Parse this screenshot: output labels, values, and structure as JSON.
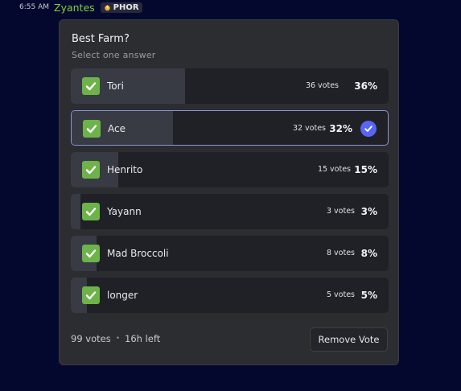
{
  "message": {
    "timestamp": "6:55 AM",
    "username": "Zyantes",
    "tag": {
      "icon": "fire-badge-icon",
      "text": "PHOR"
    }
  },
  "poll": {
    "question": "Best Farm?",
    "subtitle": "Select one answer",
    "answers": [
      {
        "label": "Tori",
        "votes": "36 votes",
        "percent": "36%",
        "fraction": 0.36,
        "selected": false
      },
      {
        "label": "Ace",
        "votes": "32 votes",
        "percent": "32%",
        "fraction": 0.32,
        "selected": true
      },
      {
        "label": "Henrito",
        "votes": "15 votes",
        "percent": "15%",
        "fraction": 0.15,
        "selected": false
      },
      {
        "label": "Yayann",
        "votes": "3 votes",
        "percent": "3%",
        "fraction": 0.03,
        "selected": false
      },
      {
        "label": "Mad Broccoli",
        "votes": "8 votes",
        "percent": "8%",
        "fraction": 0.08,
        "selected": false
      },
      {
        "label": "longer",
        "votes": "5 votes",
        "percent": "5%",
        "fraction": 0.05,
        "selected": false
      }
    ],
    "total_votes": "99 votes",
    "separator": "•",
    "time_left": "16h left",
    "remove_vote_label": "Remove Vote"
  },
  "colors": {
    "background": "#04082e",
    "username": "#7bd33c",
    "checkbox": "#6db34a",
    "selected_accent": "#5865f2"
  }
}
